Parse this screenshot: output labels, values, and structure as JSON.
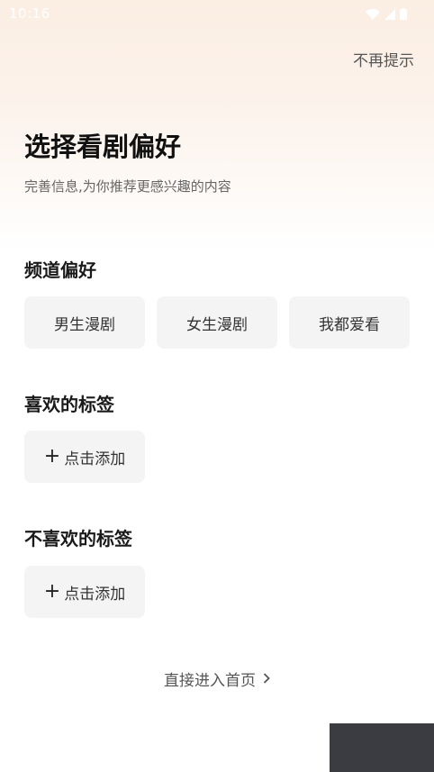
{
  "status_bar": {
    "time": "10:16",
    "icons": [
      "wifi-icon",
      "cellular-icon",
      "battery-icon"
    ]
  },
  "header": {
    "skip_label": "不再提示"
  },
  "intro": {
    "title": "选择看剧偏好",
    "subtitle": "完善信息,为你推荐更感兴趣的内容"
  },
  "channel_preference": {
    "title": "频道偏好",
    "options": [
      {
        "label": "男生漫剧"
      },
      {
        "label": "女生漫剧"
      },
      {
        "label": "我都爱看"
      }
    ]
  },
  "liked_tags": {
    "title": "喜欢的标签",
    "add_label": "点击添加"
  },
  "disliked_tags": {
    "title": "不喜欢的标签",
    "add_label": "点击添加"
  },
  "footer": {
    "enter_home_label": "直接进入首页"
  },
  "colors": {
    "gradient_top": "#fbeee3",
    "chip_bg": "#f4f4f4",
    "title_text": "#111111",
    "secondary_text": "#666666"
  }
}
